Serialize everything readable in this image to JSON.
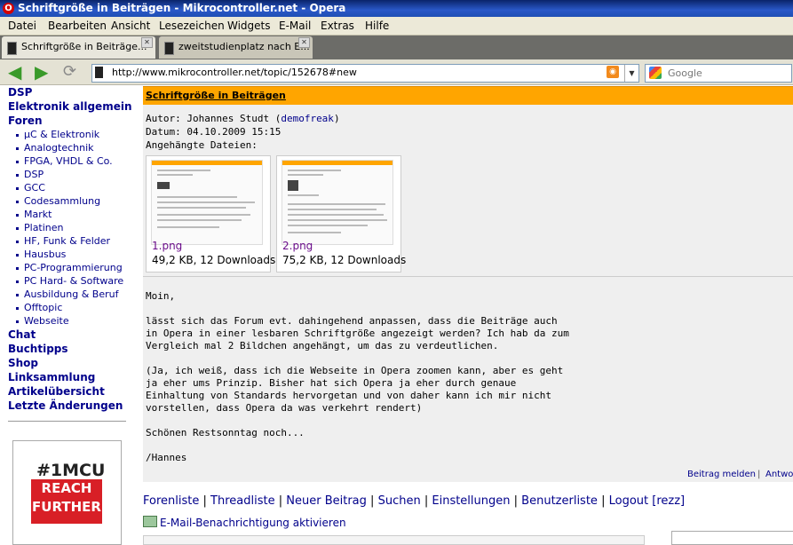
{
  "window": {
    "title": "Schriftgröße in Beiträgen - Mikrocontroller.net - Opera"
  },
  "menu": [
    "Datei",
    "Bearbeiten",
    "Ansicht",
    "Lesezeichen",
    "Widgets",
    "E-Mail",
    "Extras",
    "Hilfe"
  ],
  "tabs": [
    {
      "label": "Schriftgröße in Beiträge...",
      "active": true
    },
    {
      "label": "zweitstudienplatz nach E...",
      "active": false
    }
  ],
  "address": {
    "url": "http://www.mikrocontroller.net/topic/152678#new"
  },
  "search": {
    "placeholder": "Google"
  },
  "sidebar": {
    "top1": [
      "DSP",
      "Elektronik allgemein",
      "Foren"
    ],
    "forums": [
      "µC & Elektronik",
      "Analogtechnik",
      "FPGA, VHDL & Co.",
      "DSP",
      "GCC",
      "Codesammlung",
      "Markt",
      "Platinen",
      "HF, Funk & Felder",
      "Hausbus",
      "PC-Programmierung",
      "PC Hard- & Software",
      "Ausbildung & Beruf",
      "Offtopic",
      "Webseite"
    ],
    "top2": [
      "Chat",
      "Buchtipps",
      "Shop",
      "Linksammlung",
      "Artikelübersicht",
      "Letzte Änderungen"
    ],
    "ad": {
      "brand": "#1MCU",
      "line1": "REACH",
      "line2": "FURTHER"
    }
  },
  "post": {
    "title": "Schriftgröße in Beiträgen",
    "author_line": "Autor: Johannes Studt (",
    "author_user": "demofreak",
    "author_close": ")",
    "date_line": "Datum: 04.10.2009 15:15",
    "attach_label": "Angehängte Dateien:",
    "attachments": [
      {
        "name": "1.png",
        "info": "49,2 KB, 12 Downloads"
      },
      {
        "name": "2.png",
        "info": "75,2 KB, 12 Downloads"
      }
    ],
    "body": [
      "Moin,",
      "",
      "lässt sich das Forum evt. dahingehend anpassen, dass die Beiträge auch",
      "in Opera in einer lesbaren Schriftgröße angezeigt werden? Ich hab da zum",
      "Vergleich mal 2 Bildchen angehängt, um das zu verdeutlichen.",
      "",
      "(Ja, ich weiß, dass ich die Webseite in Opera zoomen kann, aber es geht",
      "ja eher ums Prinzip. Bisher hat sich Opera ja eher durch genaue",
      "Einhaltung von Standards hervorgetan und von daher kann ich mir nicht",
      "vorstellen, dass Opera da was verkehrt rendert)",
      "",
      "Schönen Restsonntag noch...",
      "",
      "/Hannes"
    ],
    "report_label": "Beitrag melden",
    "pipe": "|",
    "reply_label": "Antwort"
  },
  "footer": {
    "links": [
      "Forenliste",
      "Threadliste",
      "Neuer Beitrag",
      "Suchen",
      "Einstellungen",
      "Benutzerliste",
      "Logout [rezz]"
    ],
    "email_notify": "E-Mail-Benachrichtigung aktivieren"
  }
}
